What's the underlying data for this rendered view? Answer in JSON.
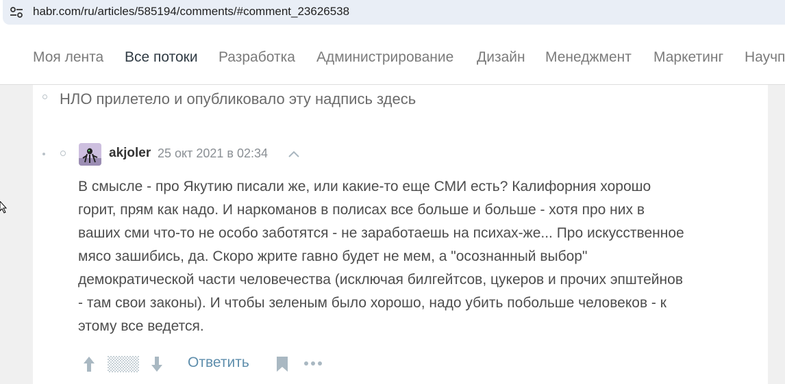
{
  "browser": {
    "url": "habr.com/ru/articles/585194/comments/#comment_23626538",
    "site_icon": "tune-icon"
  },
  "nav": {
    "items": [
      {
        "label": "Моя лента",
        "active": false
      },
      {
        "label": "Все потоки",
        "active": true
      },
      {
        "label": "Разработка",
        "active": false
      },
      {
        "label": "Администрирование",
        "active": false
      },
      {
        "label": "Дизайн",
        "active": false
      },
      {
        "label": "Менеджмент",
        "active": false
      },
      {
        "label": "Маркетинг",
        "active": false
      },
      {
        "label": "Научпоп",
        "active": false
      }
    ]
  },
  "ufo_notice": "НЛО прилетело и опубликовало эту надпись здесь",
  "comment": {
    "author": "akjoler",
    "timestamp": "25 окт 2021 в 02:34",
    "lines": [
      "В смысле - про Якутию писали же, или какие-то еще СМИ есть? Калифорния хорошо",
      "горит, прям как надо. И наркоманов в полисах все больше и больше - хотя про них в",
      "ваших сми что-то не особо заботятся - не заработаешь на психах-же... Про искусственное",
      "мясо зашибись, да. Скоро жрите гавно будет не мем, а \"осознанный выбор\"",
      "демократической части человечества (исключая билгейтсов, цукеров и прочих эпштейнов",
      "- там свои законы). И чтобы зеленым было хорошо, надо убить побольше человеков - к",
      "этому все ведется."
    ],
    "reply_label": "Ответить",
    "icons": {
      "collapse": "chevron-up-icon",
      "vote_up": "arrow-up-icon",
      "score": "hidden-score-icon",
      "vote_down": "arrow-down-icon",
      "bookmark": "bookmark-icon",
      "more": "more-dots-icon"
    }
  },
  "colors": {
    "accent_link": "#5e8eac",
    "active_nav": "#303b44",
    "inactive_nav": "#7b7b7b",
    "background": "#f0f0f0",
    "url_bar": "#e9eef6"
  }
}
